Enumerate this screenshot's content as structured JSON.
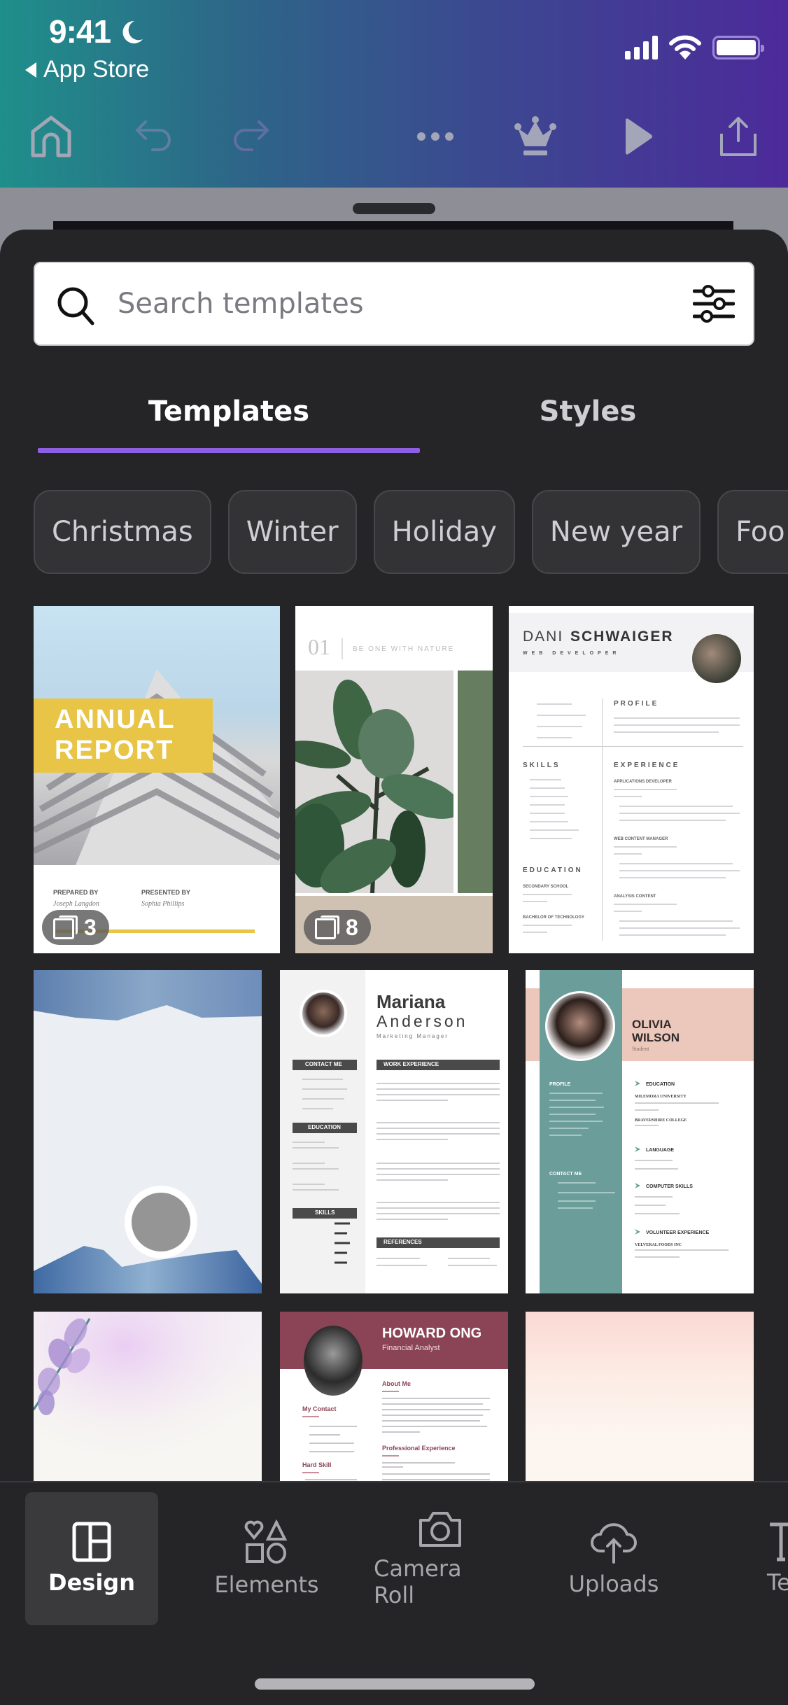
{
  "status_bar": {
    "time": "9:41",
    "back_label": "App Store"
  },
  "toolbar": {
    "icons": [
      "home-icon",
      "undo-icon",
      "redo-icon",
      "more-icon",
      "crown-icon",
      "play-icon",
      "share-icon"
    ]
  },
  "search": {
    "placeholder": "Search templates",
    "value": ""
  },
  "tabs": [
    {
      "label": "Templates",
      "active": true
    },
    {
      "label": "Styles",
      "active": false
    }
  ],
  "chips": [
    "Christmas",
    "Winter",
    "Holiday",
    "New year",
    "Foo"
  ],
  "templates": {
    "row1": [
      {
        "title_line1": "ANNUAL",
        "title_line2": "REPORT",
        "prepared_label": "PREPARED BY",
        "prepared_name": "Joseph Langdon",
        "presented_label": "PRESENTED BY",
        "presented_name": "Sophia Phillips",
        "page_count": "3"
      },
      {
        "number": "01",
        "tagline": "BE ONE WITH NATURE",
        "page_count": "8"
      },
      {
        "first_name": "DANI",
        "last_name": "SCHWAIGER",
        "role": "WEB DEVELOPER",
        "sections": [
          "PROFILE",
          "SKILLS",
          "EXPERIENCE",
          "EDUCATION"
        ],
        "jobs": [
          "APPLICATIONS DEVELOPER",
          "WEB CONTENT MANAGER",
          "ANALYSIS CONTENT"
        ],
        "schools": [
          "SECONDARY SCHOOL",
          "BACHELOR OF TECHNOLOGY"
        ]
      }
    ],
    "row2": [
      {
        "kind": "watercolor-blank"
      },
      {
        "first_name": "Mariana",
        "last_name": "Anderson",
        "role": "Marketing Manager",
        "sections": [
          "CONTACT ME",
          "EDUCATION",
          "SKILLS",
          "WORK EXPERIENCE",
          "REFERENCES"
        ]
      },
      {
        "name_line1": "OLIVIA",
        "name_line2": "WILSON",
        "role": "Student",
        "left_sections": [
          "PROFILE",
          "CONTACT ME"
        ],
        "right_sections": [
          "EDUCATION",
          "LANGUAGE",
          "COMPUTER SKILLS",
          "VOLUNTEER EXPERIENCE"
        ],
        "schools": [
          "MILEMORA UNIVERSITY",
          "BRAVERSHIRE COLLEGE"
        ],
        "volunteer": "VELVERAL FOODS INC"
      }
    ],
    "row3": [
      {
        "kind": "floral-blank"
      },
      {
        "name": "HOWARD ONG",
        "role": "Financial Analyst",
        "sections": [
          "About Me",
          "My Contact",
          "Professional Experience",
          "Hard Skill"
        ]
      },
      {
        "kind": "pink-watercolor-blank"
      }
    ]
  },
  "bottom_nav": [
    {
      "label": "Design",
      "icon": "design-layout-icon",
      "active": true
    },
    {
      "label": "Elements",
      "icon": "elements-shapes-icon",
      "active": false
    },
    {
      "label": "Camera Roll",
      "icon": "camera-icon",
      "active": false
    },
    {
      "label": "Uploads",
      "icon": "cloud-upload-icon",
      "active": false
    },
    {
      "label": "Te",
      "icon": "text-icon",
      "active": false
    }
  ],
  "colors": {
    "accent": "#8d5fe3",
    "header_gradient_start": "#1f8f8a",
    "header_gradient_end": "#4c2a9a",
    "sheet_bg": "#252528",
    "annual_yellow": "#e8c547",
    "olivia_teal": "#6b9e9a",
    "olivia_pink": "#ecc7bb",
    "howard_maroon": "#8b4455",
    "plant_green": "#667d5f"
  }
}
